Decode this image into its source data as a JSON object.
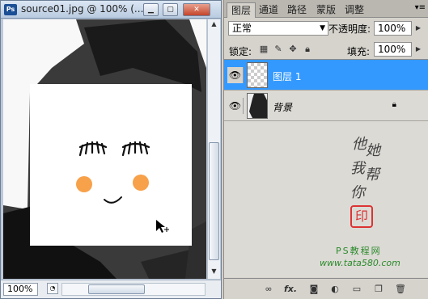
{
  "document": {
    "app_icon": "Ps",
    "title": "source01.jpg @ 100% (...",
    "zoom": "100%"
  },
  "panel": {
    "tabs": [
      "图层",
      "通道",
      "路径",
      "蒙版",
      "调整"
    ],
    "blend_mode": "正常",
    "opacity_label": "不透明度:",
    "opacity_value": "100%",
    "lock_label": "锁定:",
    "fill_label": "填充:",
    "fill_value": "100%",
    "layers": [
      {
        "name": "图层 1",
        "selected": true,
        "visible": true
      },
      {
        "name": "背景",
        "selected": false,
        "visible": true,
        "locked": true
      }
    ],
    "watermark": {
      "text_chars": [
        "他",
        "她",
        "我",
        "帮",
        "你"
      ],
      "seal": "印",
      "site": "PS教程网",
      "url": "www.tata580.com"
    }
  },
  "colors": {
    "selection": "#3399ff",
    "blush": "#f7a14a"
  }
}
